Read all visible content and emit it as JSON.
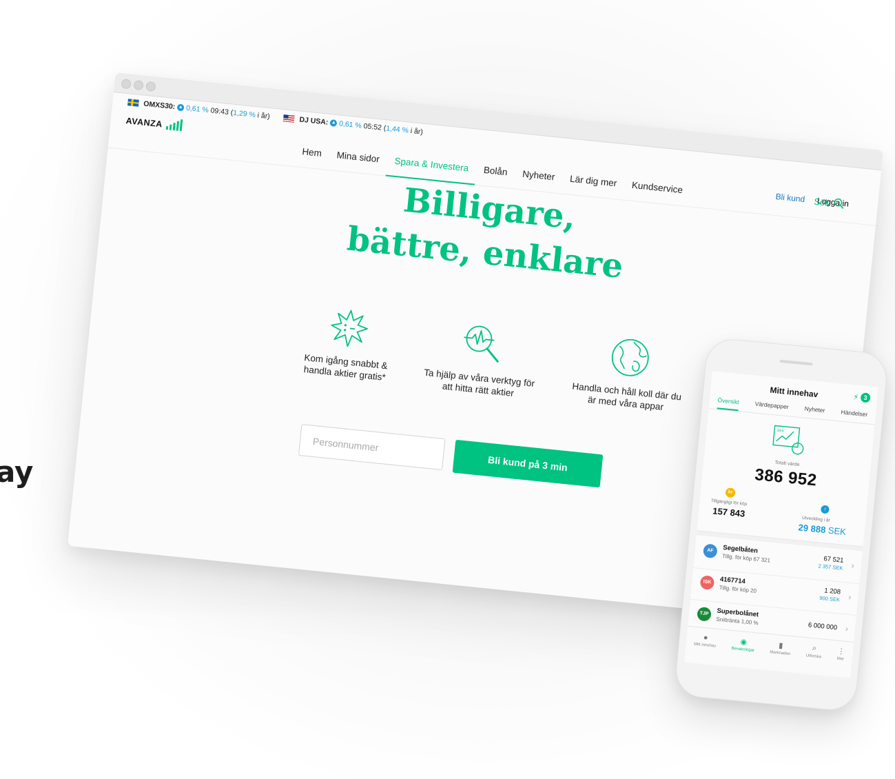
{
  "clipped_text": "ay",
  "colors": {
    "accent": "#00c281",
    "link_blue": "#1a78c2",
    "info_blue": "#1a9ad6"
  },
  "ticker": [
    {
      "flag": "sweden-flag",
      "name": "OMXS30:",
      "change": "0,61 %",
      "time": "09:43",
      "year_open": "(",
      "year": "1,29 %",
      "year_close": " i år)"
    },
    {
      "flag": "usa-flag",
      "name": "DJ USA:",
      "change": "0,61 %",
      "time": "05:52",
      "year_open": "(",
      "year": "1,44 %",
      "year_close": " i år)"
    }
  ],
  "header": {
    "logo_text": "AVANZA",
    "nav": [
      "Hem",
      "Mina sidor",
      "Spara & Investera",
      "Bolån",
      "Nyheter",
      "Lär dig mer",
      "Kundservice"
    ],
    "active_nav": "Spara & Investera",
    "signup": "Bli kund",
    "login": "Logga in",
    "search": "Sök"
  },
  "hero": {
    "line1": "Billigare,",
    "line2": "bättre, enklare"
  },
  "features": [
    {
      "icon": "burst-icon",
      "line1": "Kom igång snabbt &",
      "line2": "handla aktier gratis*"
    },
    {
      "icon": "magnifier-chart-icon",
      "line1": "Ta hjälp av våra verktyg för",
      "line2": "att hitta rätt aktier"
    },
    {
      "icon": "globe-icon",
      "line1": "Handla och håll koll där du",
      "line2": "är med våra appar"
    }
  ],
  "signup_form": {
    "placeholder": "Personnummer",
    "button": "Bli kund på 3 min"
  },
  "phone": {
    "title": "Mitt innehav",
    "badge_count": "3",
    "tabs": [
      "Översikt",
      "Värdepapper",
      "Nyheter",
      "Händelser"
    ],
    "active_tab": "Översikt",
    "chart_label": "SEK",
    "total_label": "Totalt värde",
    "total": "386 952",
    "coin_label": "kr",
    "available_label": "Tillgängligt för köp",
    "available": "157 843",
    "development_label": "Utveckling i år",
    "development": "29 888",
    "development_unit": "SEK",
    "accounts": [
      {
        "badge": "AF",
        "badge_color": "#3b8fd6",
        "name": "Segelbåten",
        "sub": "Tillg. för köp 67 321",
        "value": "67 521",
        "change": "2 357 SEK"
      },
      {
        "badge": "ISK",
        "badge_color": "#ef6461",
        "name": "4167714",
        "sub": "Tillg. för köp 20",
        "value": "1 208",
        "change": "900 SEK"
      },
      {
        "badge": "TJP",
        "badge_color": "#1a8a3a",
        "name": "Superbolånet",
        "sub": "Snittränta 1,00 %",
        "value": "6 000 000",
        "change": ""
      }
    ],
    "bottom_nav": [
      "Mitt innehav",
      "Bevakningar",
      "Marknaden",
      "Utforska",
      "Mer"
    ],
    "active_bottom": "Bevakningar"
  }
}
